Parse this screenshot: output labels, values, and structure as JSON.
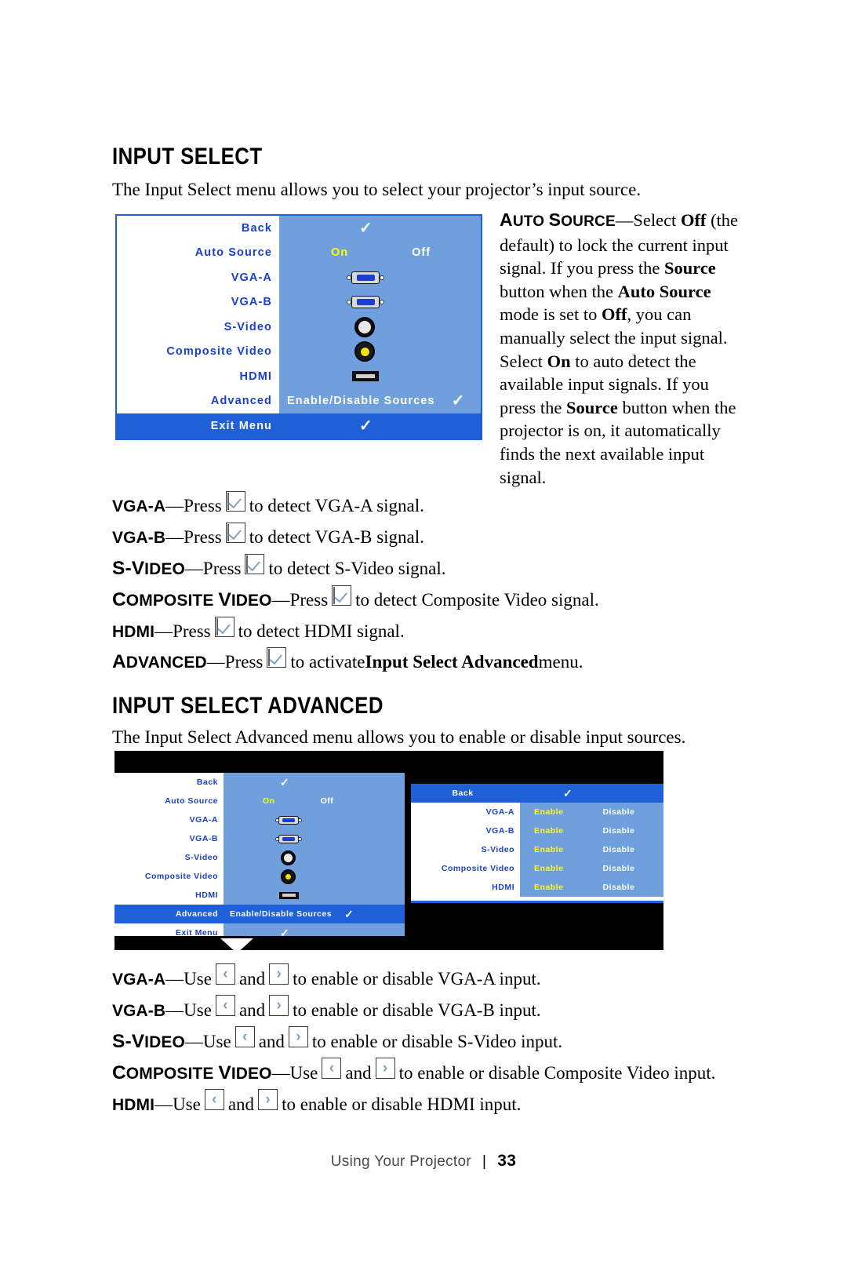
{
  "section1": {
    "heading": "INPUT SELECT",
    "intro": "The Input Select menu allows you to select your projector’s input source.",
    "osd": {
      "rows": [
        {
          "label": "Back",
          "value_type": "check"
        },
        {
          "label": "Auto Source",
          "value_type": "onoff",
          "on": "On",
          "off": "Off"
        },
        {
          "label": "VGA-A",
          "value_type": "icon-vga"
        },
        {
          "label": "VGA-B",
          "value_type": "icon-vga"
        },
        {
          "label": "S-Video",
          "value_type": "icon-svideo"
        },
        {
          "label": "Composite Video",
          "value_type": "icon-composite"
        },
        {
          "label": "HDMI",
          "value_type": "icon-hdmi"
        },
        {
          "label": "Advanced",
          "value_type": "text-check",
          "text": "Enable/Disable Sources"
        },
        {
          "label": "Exit Menu",
          "value_type": "check",
          "selected": true
        }
      ]
    },
    "side_paragraph": {
      "term": "Auto Source",
      "dash": "—",
      "t1": "Select ",
      "b1": "Off",
      "t2": " (the default) to lock the current input signal. If you press the ",
      "b2": "Source",
      "t3": " button when the ",
      "b3": "Auto Source",
      "t4": " mode is set to ",
      "b4": "Off",
      "t5": ", you can manually select the input signal. Select ",
      "b5": "On",
      "t6": " to auto detect the available input signals. If you press the ",
      "b6": "Source",
      "t7": " button when the projector is on, it automatically finds the next available input signal."
    },
    "bullets": [
      {
        "term": "VGA-A",
        "caps": "",
        "dash": "—",
        "pre": "Press ",
        "icon": "check-button-icon",
        "post": " to detect VGA-A signal."
      },
      {
        "term": "VGA-B",
        "caps": "",
        "dash": "—",
        "pre": "Press ",
        "icon": "check-button-icon",
        "post": " to detect VGA-B signal."
      },
      {
        "term": "S-Video",
        "caps": "S-V",
        "dash": "—",
        "pre": "Press ",
        "icon": "check-button-icon",
        "post": " to detect S-Video signal."
      },
      {
        "term": "Composite Video",
        "caps": "C",
        "dash": "—",
        "pre": "Press ",
        "icon": "check-button-icon",
        "post": " to detect Composite Video signal."
      },
      {
        "term": "HDMI",
        "caps": "",
        "dash": "—",
        "pre": "Press ",
        "icon": "check-button-icon",
        "post": " to detect HDMI signal."
      },
      {
        "term": "Advanced",
        "caps": "A",
        "dash": "—",
        "pre": "Press ",
        "icon": "check-button-icon",
        "post": " to activate ",
        "bold_tail": "Input Select Advanced",
        "tail": " menu."
      }
    ]
  },
  "section2": {
    "heading": "INPUT SELECT ADVANCED",
    "intro": "The Input Select Advanced menu allows you to enable or disable input sources.",
    "osd_left": {
      "rows": [
        {
          "label": "Back",
          "value_type": "check"
        },
        {
          "label": "Auto Source",
          "value_type": "onoff",
          "on": "On",
          "off": "Off"
        },
        {
          "label": "VGA-A",
          "value_type": "icon-vga"
        },
        {
          "label": "VGA-B",
          "value_type": "icon-vga"
        },
        {
          "label": "S-Video",
          "value_type": "icon-svideo"
        },
        {
          "label": "Composite Video",
          "value_type": "icon-composite"
        },
        {
          "label": "HDMI",
          "value_type": "icon-hdmi"
        },
        {
          "label": "Advanced",
          "value_type": "text-check",
          "text": "Enable/Disable Sources",
          "selected": true
        },
        {
          "label": "Exit Menu",
          "value_type": "check"
        }
      ]
    },
    "osd_right": {
      "rows": [
        {
          "label": "Back",
          "value_type": "check",
          "selected": true
        },
        {
          "label": "VGA-A",
          "value_type": "endis",
          "enable": "Enable",
          "disable": "Disable"
        },
        {
          "label": "VGA-B",
          "value_type": "endis",
          "enable": "Enable",
          "disable": "Disable"
        },
        {
          "label": "S-Video",
          "value_type": "endis",
          "enable": "Enable",
          "disable": "Disable"
        },
        {
          "label": "Composite Video",
          "value_type": "endis",
          "enable": "Enable",
          "disable": "Disable"
        },
        {
          "label": "HDMI",
          "value_type": "endis",
          "enable": "Enable",
          "disable": "Disable"
        }
      ]
    },
    "bullets": [
      {
        "term": "VGA-A",
        "caps": "",
        "dash": "—",
        "pre": "Use ",
        "mid": " and ",
        "post": " to enable or disable VGA-A input."
      },
      {
        "term": "VGA-B",
        "caps": "",
        "dash": "—",
        "pre": "Use ",
        "mid": " and ",
        "post": " to enable or disable VGA-B input."
      },
      {
        "term": "S-Video",
        "caps": "S-V",
        "dash": "—",
        "pre": "Use ",
        "mid": " and ",
        "post": " to enable or disable S-Video input."
      },
      {
        "term": "Composite Video",
        "caps": "C",
        "dash": "—",
        "pre": "Use ",
        "mid": " and ",
        "post": " to enable or disable Composite Video input."
      },
      {
        "term": "HDMI",
        "caps": "",
        "dash": "—",
        "pre": "Use ",
        "mid": " and ",
        "post": " to enable or disable HDMI input."
      }
    ],
    "arrows": {
      "left": "‹",
      "right": "›"
    }
  },
  "footer": {
    "text": "Using Your Projector",
    "separator": "|",
    "page": "33"
  },
  "colors": {
    "osd_label_blue": "#1a3fcf",
    "osd_panel_blue": "#6fa0dd",
    "osd_highlight_blue": "#1f5fd8",
    "osd_yellow": "#ffff00",
    "osd_white": "#ffffff",
    "black": "#000000"
  }
}
